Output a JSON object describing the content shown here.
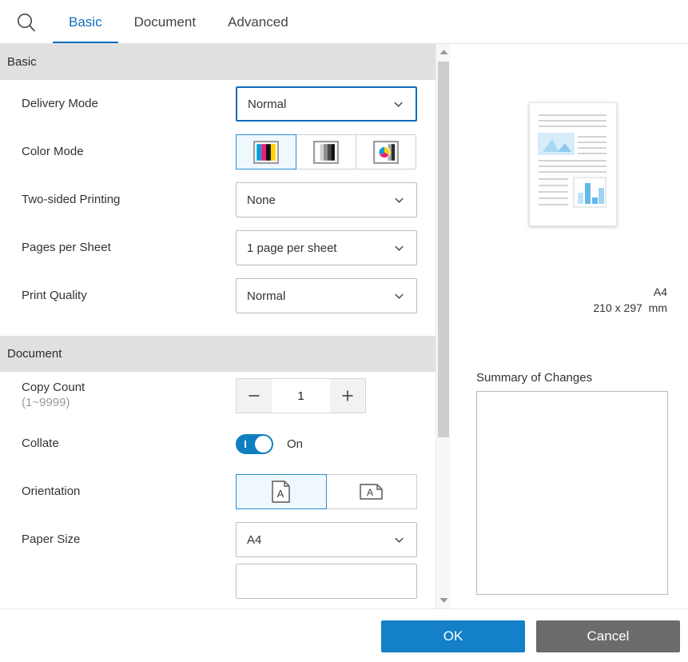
{
  "tabs": [
    {
      "label": "Basic",
      "active": true
    },
    {
      "label": "Document",
      "active": false
    },
    {
      "label": "Advanced",
      "active": false
    }
  ],
  "search_icon": "search-icon",
  "sections": [
    {
      "title": "Basic",
      "rows": [
        {
          "label": "Delivery Mode",
          "type": "dropdown",
          "value": "Normal",
          "focused": true
        },
        {
          "label": "Color Mode",
          "type": "segment-color",
          "selected": 0
        },
        {
          "label": "Two-sided Printing",
          "type": "dropdown",
          "value": "None",
          "focused": false
        },
        {
          "label": "Pages per Sheet",
          "type": "dropdown",
          "value": "1 page per sheet",
          "focused": false
        },
        {
          "label": "Print Quality",
          "type": "dropdown",
          "value": "Normal",
          "focused": false
        }
      ]
    },
    {
      "title": "Document",
      "rows": [
        {
          "label": "Copy Count",
          "sublabel": "(1~9999)",
          "type": "stepper",
          "value": "1",
          "minus": "—",
          "plus": "+"
        },
        {
          "label": "Collate",
          "type": "toggle",
          "state": "On"
        },
        {
          "label": "Orientation",
          "type": "segment-orientation",
          "selected": 0
        },
        {
          "label": "Paper Size",
          "type": "dropdown",
          "value": "A4",
          "focused": false
        }
      ]
    }
  ],
  "color_mode_options": [
    {
      "name": "color-cmyk-icon"
    },
    {
      "name": "grayscale-icon"
    },
    {
      "name": "color-wheel-icon"
    }
  ],
  "orientation_options": [
    {
      "name": "portrait-icon"
    },
    {
      "name": "landscape-icon"
    }
  ],
  "preview": {
    "paper_name": "A4",
    "paper_dims": "210 x 297",
    "paper_units": "mm"
  },
  "summary": {
    "label": "Summary of Changes",
    "content": ""
  },
  "footer": {
    "ok_label": "OK",
    "cancel_label": "Cancel"
  },
  "colors": {
    "accent": "#0f6cbd",
    "ok_button": "#1380c7",
    "cancel_button": "#6b6b6b",
    "toggle_on": "#0f7fc1",
    "section_header": "#e0e0e0",
    "selected_tile": "#eff8fd",
    "selected_border": "#2a8fd4"
  }
}
